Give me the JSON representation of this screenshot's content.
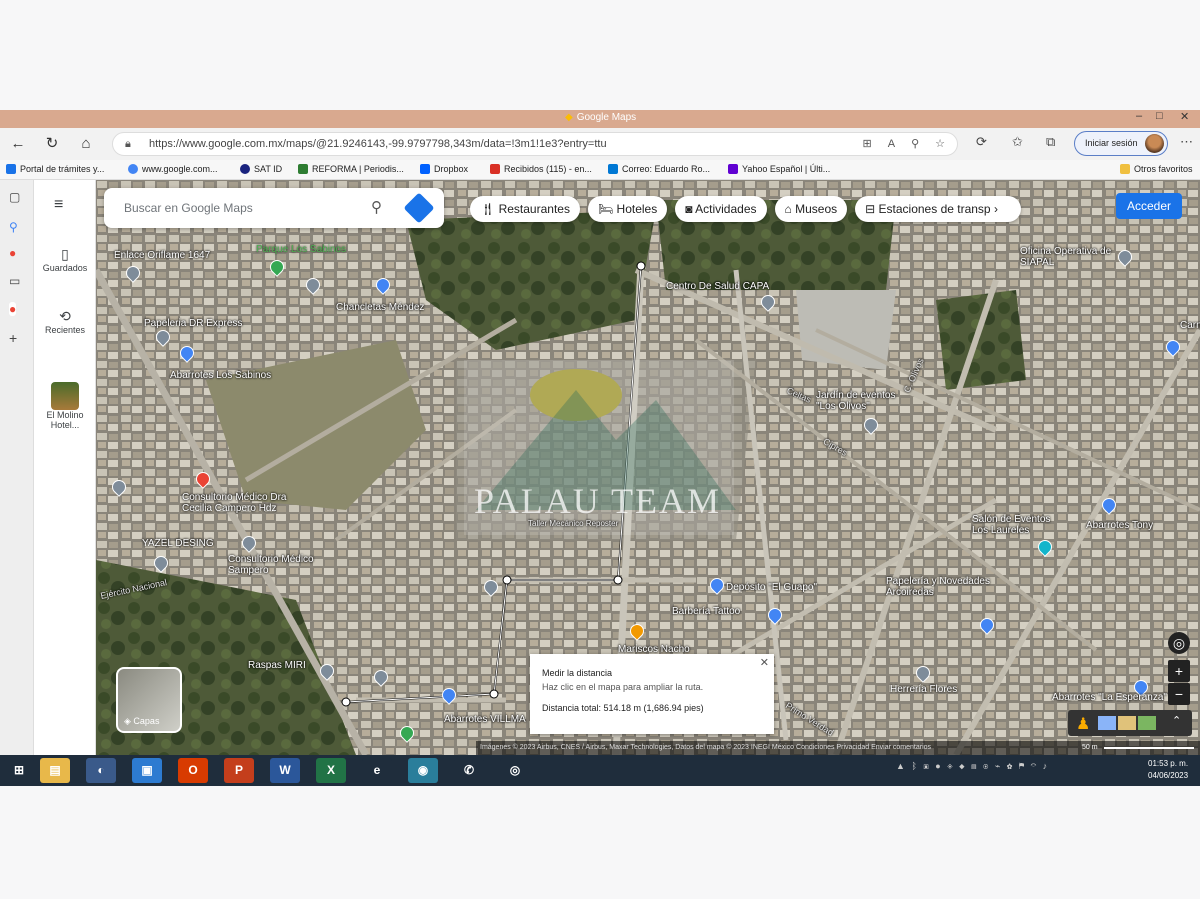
{
  "window": {
    "title": "Google Maps",
    "controls": [
      "–",
      "□",
      "✕"
    ]
  },
  "browser": {
    "url": "https://www.google.com.mx/maps/@21.9246143,-99.9797798,343m/data=!3m1!1e3?entry=ttu",
    "signin_label": "Iniciar sesión",
    "bookmarks": [
      {
        "label": "Portal de trámites y...",
        "color": "#1a73e8"
      },
      {
        "label": "www.google.com...",
        "color": "#4285f4"
      },
      {
        "label": "SAT ID",
        "color": "#1a237e"
      },
      {
        "label": "REFORMA | Periodis...",
        "color": "#2e7d32"
      },
      {
        "label": "Dropbox",
        "color": "#0061fe"
      },
      {
        "label": "Recibidos (115) - en...",
        "color": "#d93025"
      },
      {
        "label": "Correo: Eduardo Ro...",
        "color": "#0078d4"
      },
      {
        "label": "Yahoo Español | Últi...",
        "color": "#6001d2"
      }
    ],
    "other_favorites": "Otros favoritos"
  },
  "panel": {
    "menu_icon": "menu-icon",
    "saved_label": "Guardados",
    "recent_label": "Recientes",
    "place_label_1": "El Molino",
    "place_label_2": "Hotel..."
  },
  "map": {
    "search_placeholder": "Buscar en Google Maps",
    "chips": [
      "Restaurantes",
      "Hoteles",
      "Actividades",
      "Museos",
      "Estaciones de transp"
    ],
    "signin_button": "Acceder",
    "layers_label": "Capas",
    "watermark": "PALAU TEAM",
    "labels": [
      {
        "text": "Enlace Oriflame 1647",
        "kind": "lbl"
      },
      {
        "text": "Parque Los Sabinos",
        "kind": "green"
      },
      {
        "text": "Papeleria DR Express",
        "kind": "lbl"
      },
      {
        "text": "Abarrotes Los Sabinos",
        "kind": "lbl"
      },
      {
        "text": "Chancletas Méndez",
        "kind": "lbl"
      },
      {
        "text": "Centro De Salud CAPA",
        "kind": "lbl"
      },
      {
        "text": "Oficina Operativa de SIAPAL",
        "kind": "lbl"
      },
      {
        "text": "Jardín de eventos \"Los Olivos\"",
        "kind": "lbl"
      },
      {
        "text": "Consultorio Médico Dra Cecilia Campero Hdz",
        "kind": "lbl"
      },
      {
        "text": "YAZEL DESING",
        "kind": "lbl"
      },
      {
        "text": "Consultorio Médico Sampero",
        "kind": "lbl"
      },
      {
        "text": "Taller Mecánico Reposter",
        "kind": "lbl"
      },
      {
        "text": "Salón de Eventos Los Laureles",
        "kind": "lbl"
      },
      {
        "text": "Abarrotes Tony",
        "kind": "lbl"
      },
      {
        "text": "Papelería y Novedades Arcoiredas",
        "kind": "lbl"
      },
      {
        "text": "Depósito \"El Guapo\"",
        "kind": "lbl"
      },
      {
        "text": "Barbería Tattoo",
        "kind": "lbl"
      },
      {
        "text": "Mariscos Nacho",
        "kind": "lbl"
      },
      {
        "text": "Raspas MIRI",
        "kind": "lbl"
      },
      {
        "text": "Herrería Flores",
        "kind": "lbl"
      },
      {
        "text": "Abarrotes \"La Esperanza\"",
        "kind": "lbl"
      },
      {
        "text": "Abarrotes VILLMA",
        "kind": "lbl"
      },
      {
        "text": "Carnicer",
        "kind": "lbl"
      },
      {
        "text": "Ejército Nacional",
        "kind": "road"
      },
      {
        "text": "Primo Verdad",
        "kind": "road"
      },
      {
        "text": "C. Olivos",
        "kind": "road"
      },
      {
        "text": "Celtas",
        "kind": "road"
      },
      {
        "text": "Cipres",
        "kind": "road"
      }
    ],
    "measure": {
      "title": "Medir la distancia",
      "hint": "Haz clic en el mapa para ampliar la ruta.",
      "total": "Distancia total: 514.18 m (1,686.94 pies)"
    },
    "attribution": "Imágenes © 2023 Airbus, CNES / Airbus, Maxar Technologies, Datos del mapa © 2023 INEGI   México   Condiciones   Privacidad   Enviar comentarios",
    "scale": "50 m"
  },
  "taskbar": {
    "apps": [
      {
        "name": "start-button",
        "glyph": "⊞",
        "color": "#1f2d3c"
      },
      {
        "name": "file-explorer-icon",
        "glyph": "▤",
        "color": "#e8b84a"
      },
      {
        "name": "ie-icon",
        "glyph": "◐",
        "color": "#3a5a8a"
      },
      {
        "name": "photos-icon",
        "glyph": "▣",
        "color": "#2d7bd1"
      },
      {
        "name": "office-icon",
        "glyph": "O",
        "color": "#d83b01"
      },
      {
        "name": "powerpoint-icon",
        "glyph": "P",
        "color": "#c43e1c"
      },
      {
        "name": "word-icon",
        "glyph": "W",
        "color": "#2b579a"
      },
      {
        "name": "excel-icon",
        "glyph": "X",
        "color": "#217346"
      },
      {
        "name": "edge-legacy-icon",
        "glyph": "e",
        "color": "#1f2d3c"
      },
      {
        "name": "edge-icon",
        "glyph": "◉",
        "color": "#2a7e9b"
      },
      {
        "name": "whatsapp-icon",
        "glyph": "✆",
        "color": "#1f2d3c"
      },
      {
        "name": "chrome-icon",
        "glyph": "◎",
        "color": "#1f2d3c"
      }
    ],
    "time": "01:53 p. m.",
    "date": "04/06/2023"
  }
}
